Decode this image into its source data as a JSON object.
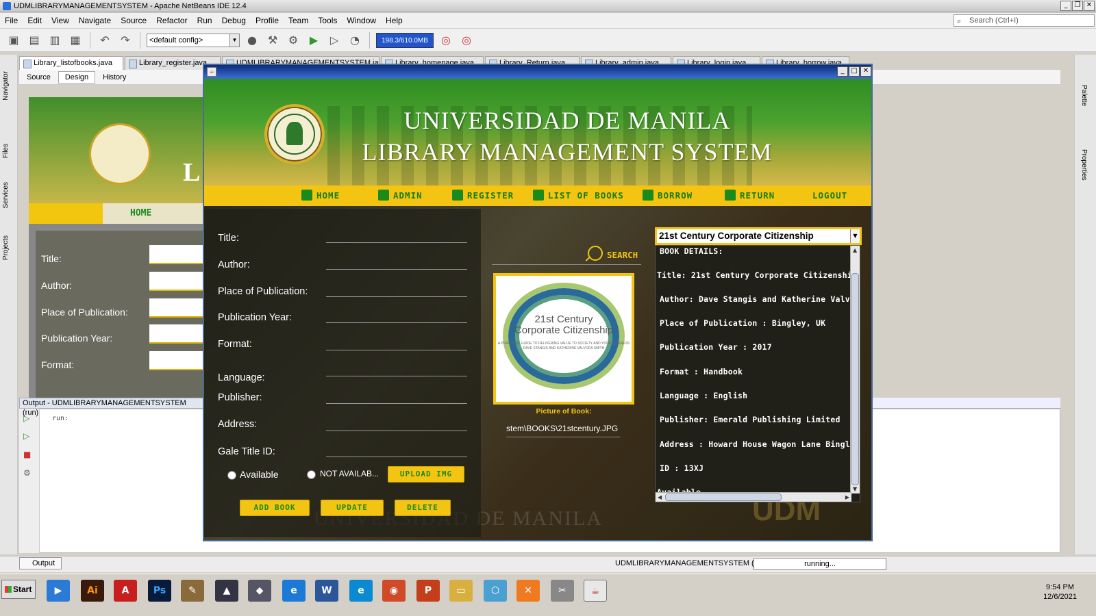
{
  "ide": {
    "window_title": "UDMLIBRARYMANAGEMENTSYSTEM - Apache NetBeans IDE 12.4",
    "menus": [
      "File",
      "Edit",
      "View",
      "Navigate",
      "Source",
      "Refactor",
      "Run",
      "Debug",
      "Profile",
      "Team",
      "Tools",
      "Window",
      "Help"
    ],
    "search_placeholder": "Search (Ctrl+I)",
    "config": "<default config>",
    "memory": "198.3/610.0MB",
    "editor_tabs": [
      "Library_listofbooks.java",
      "Library_register.java",
      "UDMLIBRARYMANAGEMENTSYSTEM.java",
      "Library_homepage.java",
      "Library_Return.java",
      "Library_admin.java",
      "Library_login.java",
      "Library_borrow.java"
    ],
    "design_tabs": [
      "Source",
      "Design",
      "History"
    ],
    "side_left": [
      "Navigator",
      "Files",
      "Services",
      "Projects"
    ],
    "side_right": [
      "Palette",
      "Properties"
    ],
    "output_title": "Output - UDMLIBRARYMANAGEMENTSYSTEM (run)",
    "output_text": "run:",
    "output_tab": "Output",
    "status_project": "UDMLIBRARYMANAGEMENTSYSTEM (run)",
    "status_progress": "running...",
    "bg_form": {
      "nav_home": "HOME",
      "labels": [
        "Title:",
        "Author:",
        "Place of Publication:",
        "Publication Year:",
        "Format:"
      ]
    }
  },
  "taskbar": {
    "start": "Start",
    "time": "9:54 PM",
    "date": "12/6/2021"
  },
  "app": {
    "title_line1": "UNIVERSIDAD DE MANILA",
    "title_line2": "LIBRARY MANAGEMENT SYSTEM",
    "nav": [
      "HOME",
      "ADMIN",
      "REGISTER",
      "LIST OF BOOKS",
      "BORROW",
      "RETURN",
      "LOGOUT"
    ],
    "form_labels": [
      "Title:",
      "Author:",
      "Place of Publication:",
      "Publication Year:",
      "Format:",
      "Language:",
      "Publisher:",
      "Address:",
      "Gale Title ID:"
    ],
    "radio_available": "Available",
    "radio_not_available": "NOT AVAILAB...",
    "upload_btn": "UPLOAD IMG",
    "add_btn": "ADD BOOK",
    "update_btn": "UPDATE",
    "delete_btn": "DELETE",
    "search_label": "SEARCH",
    "pic_caption": "Picture of Book:",
    "pic_path": "stem\\BOOKS\\21stcentury.JPG",
    "cover_title_1": "21st Century",
    "cover_title_2": "Corporate Citizenship",
    "cover_subtitle": "A PRACTICAL GUIDE TO DELIVERING VALUE TO SOCIETY AND YOUR BUSINESS",
    "cover_authors": "DAVE STANGIS AND KATHERINE VALVODA SMITH",
    "book_select": "21st Century Corporate Citizenship",
    "details": [
      "BOOK DETAILS:",
      "Title: 21st Century Corporate Citizenship",
      "Author: Dave Stangis and Katherine Valvoda",
      "Place of Publication : Bingley, UK",
      "Publication Year : 2017",
      "Format : Handbook",
      "Language : English",
      "Publisher: Emerald Publishing Limited",
      "Address : Howard House Wagon Lane Bingley",
      "ID : 13XJ",
      "Available"
    ],
    "bg_watermark": "UNIVERSIDAD DE MANILA",
    "bg_udm": "UDM"
  }
}
